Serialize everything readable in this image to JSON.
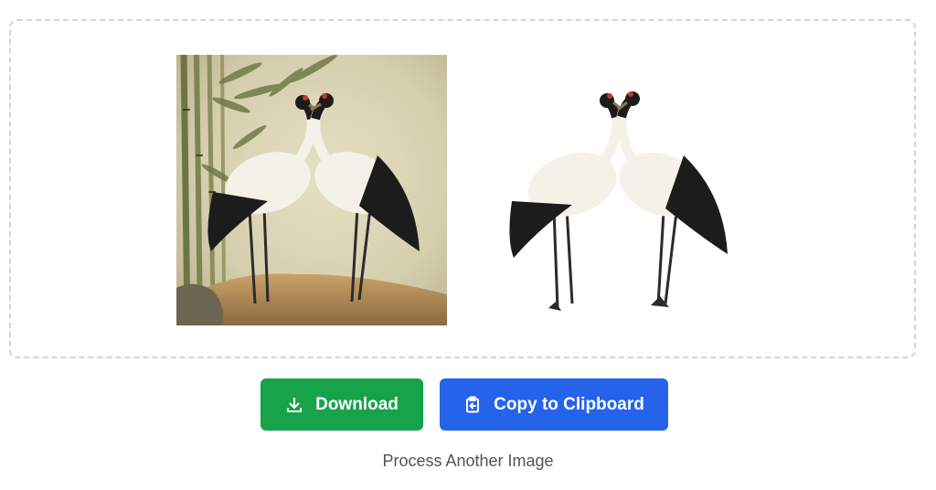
{
  "actions": {
    "download_label": "Download",
    "copy_label": "Copy to Clipboard",
    "process_another_label": "Process Another Image"
  },
  "images": {
    "original": {
      "description_icon": "original-crane-painting"
    },
    "result": {
      "description_icon": "background-removed-cranes"
    }
  },
  "colors": {
    "download": "#16a34a",
    "copy": "#2563eb",
    "link": "#52525b",
    "dropzone_border": "#d4d4d8"
  },
  "icons": {
    "download": "download-icon",
    "copy": "clipboard-icon"
  }
}
